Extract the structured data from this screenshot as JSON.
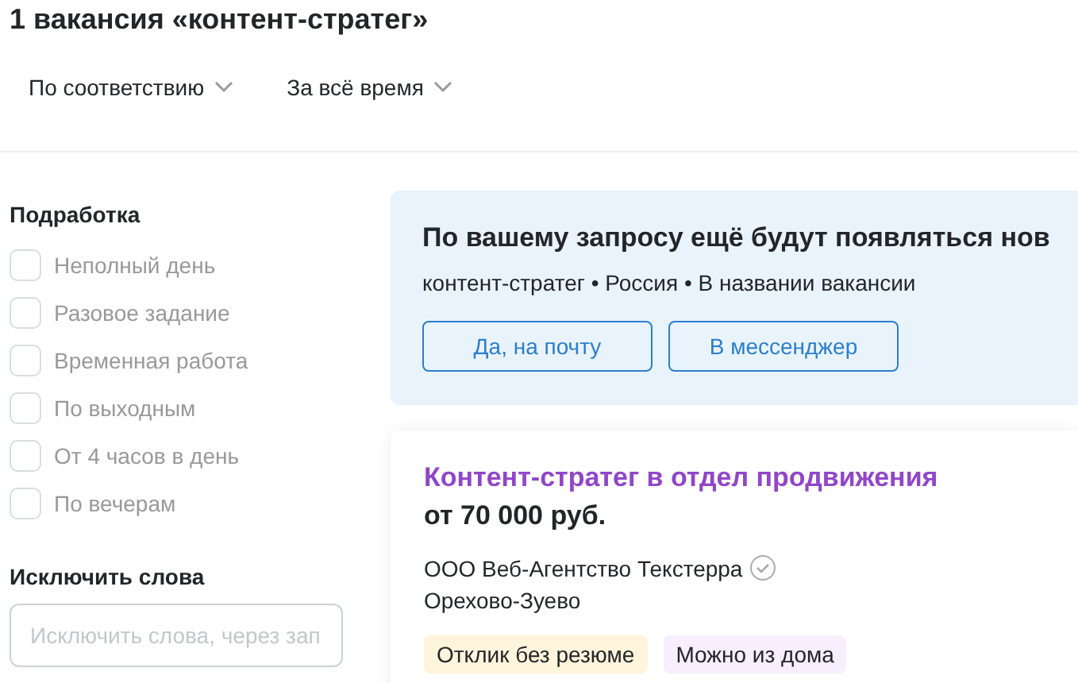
{
  "header": {
    "title": "1 вакансия «контент-стратег»"
  },
  "sort_controls": [
    {
      "label": "По соответствию"
    },
    {
      "label": "За всё время"
    }
  ],
  "sidebar": {
    "sections": [
      {
        "title": "Подработка",
        "options": [
          {
            "label": "Неполный день",
            "checked": false
          },
          {
            "label": "Разовое задание",
            "checked": false
          },
          {
            "label": "Временная работа",
            "checked": false
          },
          {
            "label": "По выходным",
            "checked": false
          },
          {
            "label": "От 4 часов в день",
            "checked": false
          },
          {
            "label": "По вечерам",
            "checked": false
          }
        ]
      }
    ],
    "exclude": {
      "title": "Исключить слова",
      "placeholder": "Исключить слова, через зап"
    }
  },
  "subscribe_banner": {
    "title": "По вашему запросу ещё будут появляться нов",
    "subtitle": "контент-стратег • Россия • В названии вакансии",
    "buttons": [
      "Да, на почту",
      "В мессенджер"
    ]
  },
  "vacancy": {
    "title": "Контент-стратег в отдел продвижения",
    "salary": "от 70 000 руб.",
    "company": "ООО Веб-Агентство Текстерра",
    "verified": true,
    "location": "Орехово-Зуево",
    "tags": [
      {
        "label": "Отклик без резюме",
        "color": "#fff5dc"
      },
      {
        "label": "Можно из дома",
        "color": "#f7eefe"
      }
    ]
  }
}
